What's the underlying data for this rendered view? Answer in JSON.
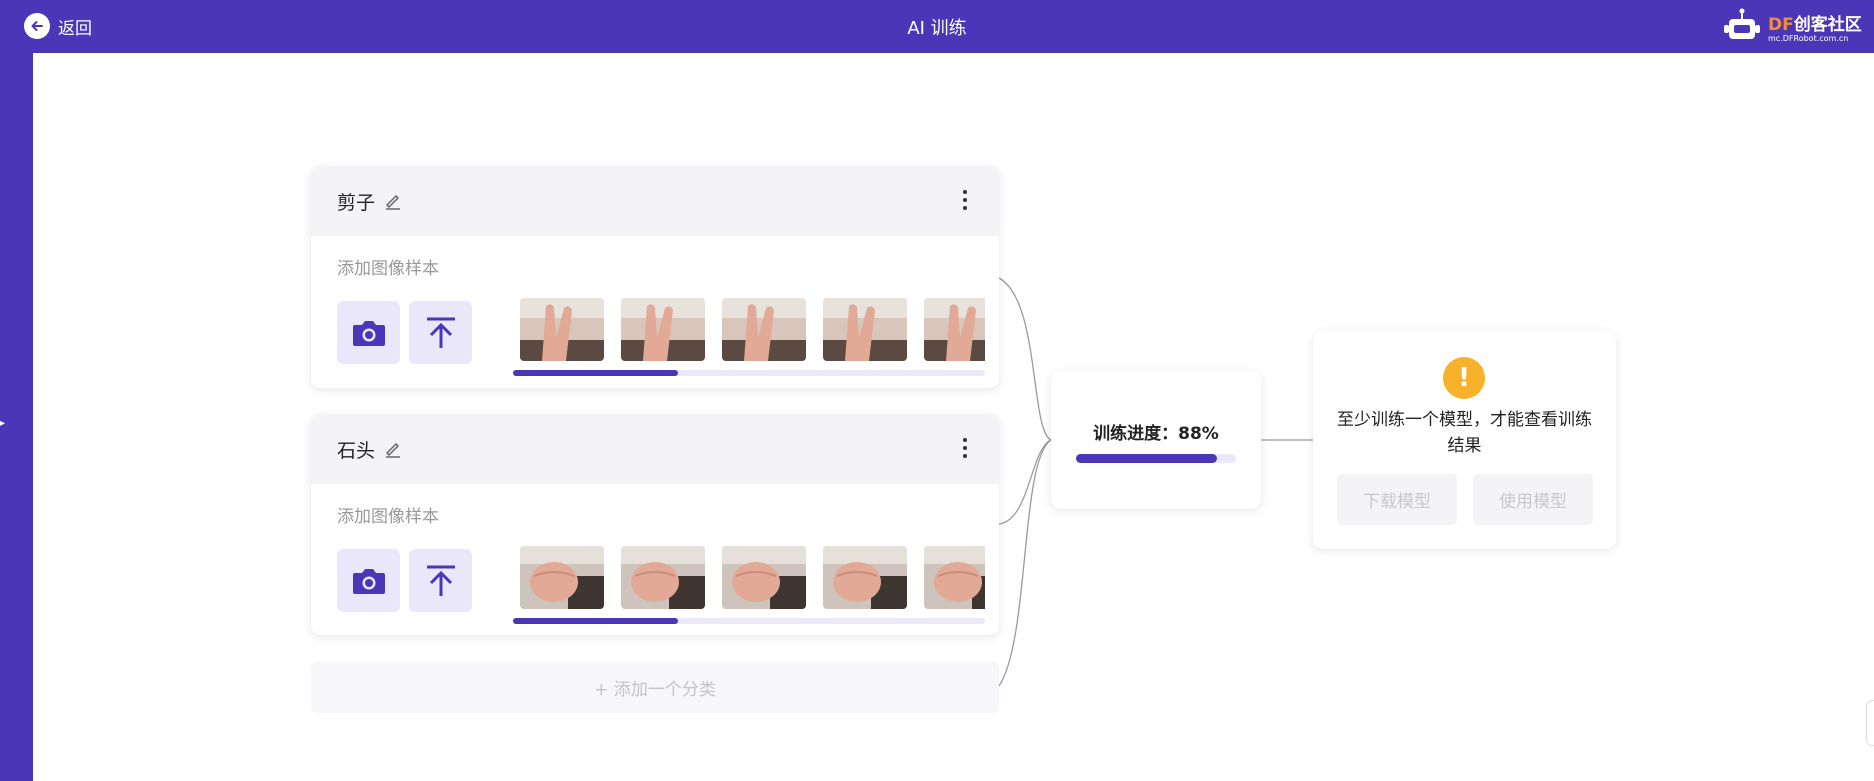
{
  "header": {
    "back_label": "返回",
    "title": "AI 训练",
    "logo_text_df": "DF",
    "logo_text_rest": "创客社区",
    "logo_sub": "mc.DFRobot.com.cn"
  },
  "classes": [
    {
      "name": "剪子",
      "add_samples_label": "添加图像样本",
      "progress_percent": 35,
      "thumbnails": [
        "hand-scissors",
        "hand-scissors",
        "hand-scissors",
        "hand-scissors",
        "hand-scissors"
      ]
    },
    {
      "name": "石头",
      "add_samples_label": "添加图像样本",
      "progress_percent": 35,
      "thumbnails": [
        "hand-fist",
        "hand-fist",
        "hand-fist",
        "hand-fist",
        "hand-fist"
      ]
    }
  ],
  "add_class_label": "+ 添加一个分类",
  "training": {
    "label": "训练进度：88%",
    "progress_percent": 88
  },
  "result": {
    "message": "至少训练一个模型，才能查看训练结果",
    "download_label": "下载模型",
    "use_label": "使用模型"
  },
  "colors": {
    "brand": "#4c36b8",
    "brand_light": "#ebe7fa",
    "warning": "#f7b12b"
  },
  "icons": [
    "back-arrow-icon",
    "edit-pencil-icon",
    "more-vertical-icon",
    "camera-icon",
    "upload-icon",
    "warning-icon"
  ]
}
